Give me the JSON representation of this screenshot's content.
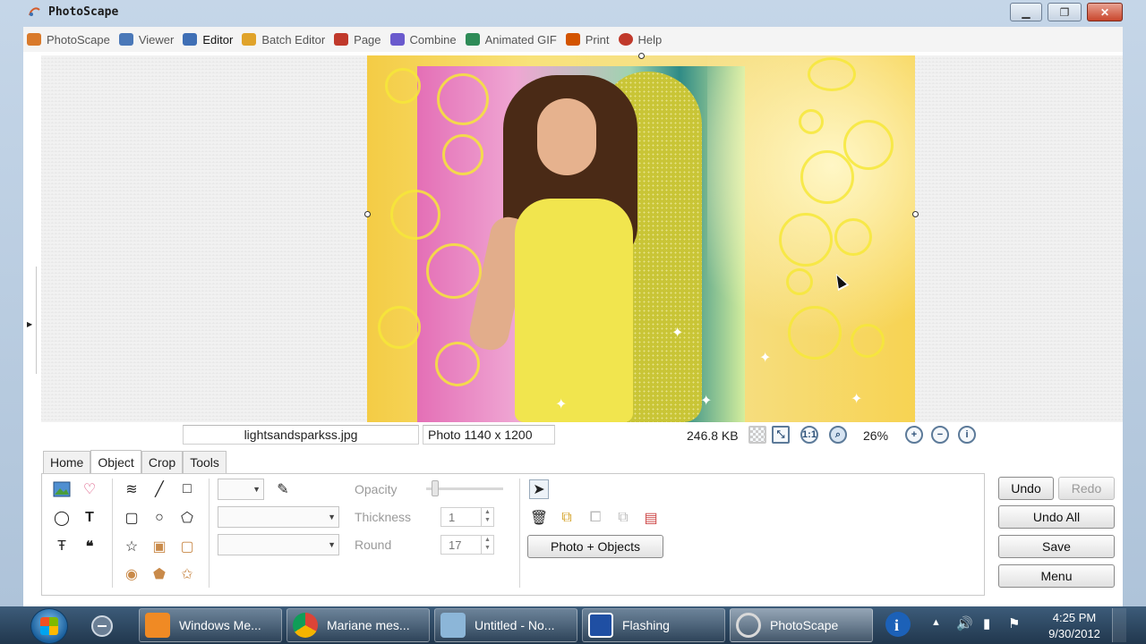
{
  "window": {
    "title": "PhotoScape",
    "controls": [
      "minimize",
      "maximize",
      "close"
    ]
  },
  "menu": [
    {
      "label": "PhotoScape",
      "icon": "photoscape-icon",
      "color": "#d97a2b"
    },
    {
      "label": "Viewer",
      "icon": "viewer-icon",
      "color": "#4a78b8"
    },
    {
      "label": "Editor",
      "icon": "editor-icon",
      "color": "#3f6fb5",
      "active": true
    },
    {
      "label": "Batch Editor",
      "icon": "batch-editor-icon",
      "color": "#e0a32a"
    },
    {
      "label": "Page",
      "icon": "page-icon",
      "color": "#c0392b"
    },
    {
      "label": "Combine",
      "icon": "combine-icon",
      "color": "#6a5acd"
    },
    {
      "label": "Animated GIF",
      "icon": "animated-gif-icon",
      "color": "#2e8b57"
    },
    {
      "label": "Print",
      "icon": "print-icon",
      "color": "#d35400"
    },
    {
      "label": "Help",
      "icon": "help-icon",
      "color": "#c0392b"
    }
  ],
  "status": {
    "filename": "lightsandsparkss.jpg",
    "photo_info": "Photo 1140 x 1200",
    "filesize": "246.8 KB",
    "zoom": "26%"
  },
  "tabs": [
    "Home",
    "Object",
    "Crop",
    "Tools"
  ],
  "active_tab": "Object",
  "props": {
    "opacity_label": "Opacity",
    "opacity_value": 0.1,
    "thickness_label": "Thickness",
    "thickness_value": "1",
    "round_label": "Round",
    "round_value": "17"
  },
  "buttons": {
    "photo_objects": "Photo + Objects",
    "undo": "Undo",
    "redo": "Redo",
    "undo_all": "Undo All",
    "save": "Save",
    "menu": "Menu"
  },
  "taskbar": {
    "tasks": [
      {
        "label": "Windows Me...",
        "icon": "windows-media-player-icon",
        "color": "#f08a24"
      },
      {
        "label": "Mariane mes...",
        "icon": "chrome-icon",
        "color": "#db4437"
      },
      {
        "label": "Untitled - No...",
        "icon": "notepad-icon",
        "color": "#8cb6d8"
      },
      {
        "label": "Flashing",
        "icon": "flashing-app-icon",
        "color": "#1f4fa3"
      },
      {
        "label": "PhotoScape",
        "icon": "photoscape-icon",
        "color": "#d9d9d9"
      }
    ],
    "time": "4:25 PM",
    "date": "9/30/2012"
  }
}
